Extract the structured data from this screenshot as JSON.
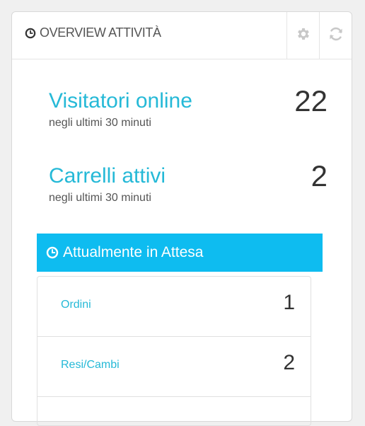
{
  "panel": {
    "title": "OVERVIEW ATTIVITÀ",
    "title_icon": "clock-icon",
    "tools": [
      {
        "name": "settings",
        "icon": "gear-icon"
      },
      {
        "name": "refresh",
        "icon": "refresh-icon"
      }
    ]
  },
  "metrics": [
    {
      "label": "Visitatori online",
      "sub": "negli ultimi 30 minuti",
      "value": "22"
    },
    {
      "label": "Carrelli attivi",
      "sub": "negli ultimi 30 minuti",
      "value": "2"
    }
  ],
  "pending": {
    "title": "Attualmente in Attesa",
    "title_icon": "clock-icon",
    "rows": [
      {
        "label": "Ordini",
        "value": "1"
      },
      {
        "label": "Resi/Cambi",
        "value": "2"
      }
    ]
  },
  "colors": {
    "accent": "#25b9d7",
    "header_bar": "#0ebcf0",
    "text_dark": "#333333",
    "text_muted": "#555555",
    "icon_muted": "#c8c8c8"
  }
}
